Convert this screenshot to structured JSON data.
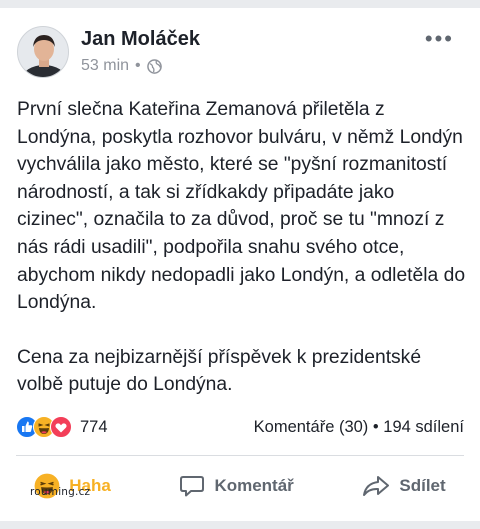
{
  "post": {
    "author": "Jan Moláček",
    "time": "53 min",
    "separator": "•",
    "privacy_icon": "globe-icon",
    "menu_icon": "more-dots-icon",
    "paragraphs": [
      "První slečna Kateřina Zemanová přiletěla z Londýna, poskytla rozhovor bulváru, v němž Londýn vychválila jako město, které se \"pyšní rozmanitostí národností, a tak si zřídkakdy připadáte jako cizinec\", označila to za důvod, proč se tu \"mnozí z nás rádi usadili\", podpořila snahu svého otce, abychom nikdy nedopadli jako Londýn, a odletěla do Londýna.",
      "Cena za nejbizarnější příspěvek k prezidentské volbě putuje do Londýna."
    ]
  },
  "stats": {
    "reaction_icons": [
      "like-icon",
      "haha-icon",
      "love-icon"
    ],
    "reaction_count": "774",
    "comments": "Komentáře (30)",
    "separator": "•",
    "shares": "194 sdílení"
  },
  "actions": {
    "like_label": "Haha",
    "comment_label": "Komentář",
    "share_label": "Sdílet"
  },
  "watermark": "rouming.cz",
  "colors": {
    "background": "#e9ebee",
    "text": "#1d2129",
    "secondary": "#90949c",
    "like_blue": "#1877f2",
    "love_red": "#f33e58",
    "haha_yellow": "#f7b125"
  }
}
